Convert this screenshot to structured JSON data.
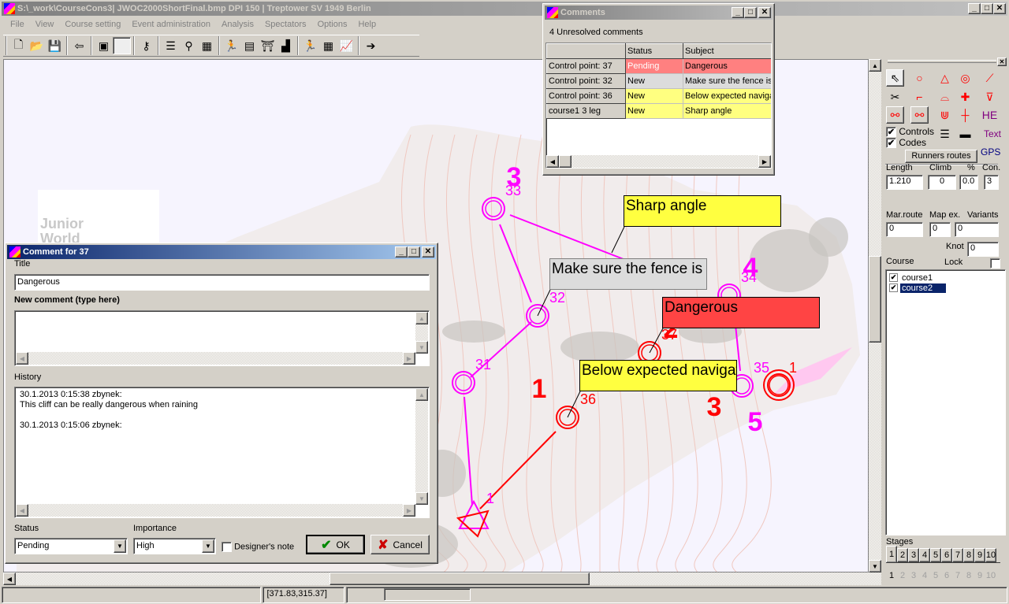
{
  "app": {
    "title": "S:\\_work\\CourseCons3| JWOC2000ShortFinal.bmp DPI 150 | Treptower SV 1949 Berlin"
  },
  "menu": [
    "File",
    "View",
    "Course setting",
    "Event administration",
    "Analysis",
    "Spectators",
    "Options",
    "Help"
  ],
  "toolbar": [
    {
      "name": "new-file",
      "glyph": "🗋"
    },
    {
      "name": "open-folder",
      "glyph": "📂"
    },
    {
      "name": "save",
      "glyph": "💾"
    },
    null,
    {
      "name": "exit",
      "glyph": "⇦"
    },
    null,
    {
      "name": "print-map",
      "glyph": "▣"
    },
    {
      "name": "blank",
      "glyph": ""
    },
    null,
    {
      "name": "key",
      "glyph": "⚷"
    },
    null,
    {
      "name": "list",
      "glyph": "☰"
    },
    {
      "name": "course-tree",
      "glyph": "⚲"
    },
    {
      "name": "grid-controls",
      "glyph": "▦"
    },
    null,
    {
      "name": "runner",
      "glyph": "🏃"
    },
    {
      "name": "counter",
      "glyph": "▤"
    },
    {
      "name": "finish-gate",
      "glyph": "⛩"
    },
    {
      "name": "podium",
      "glyph": "▟"
    },
    null,
    {
      "name": "runner-route",
      "glyph": "🏃"
    },
    {
      "name": "table",
      "glyph": "▦"
    },
    {
      "name": "chart",
      "glyph": "📈"
    },
    null,
    {
      "name": "runner-arrow",
      "glyph": "➔"
    }
  ],
  "comments_window": {
    "title": "Comments",
    "summary": "4 Unresolved comments",
    "headers": [
      "",
      "Status",
      "Subject"
    ],
    "rows": [
      {
        "item": "Control point: 37",
        "status": "Pending",
        "subject": "Dangerous",
        "color": "#ff8080",
        "text_color": "#ffffff"
      },
      {
        "item": "Control point: 32",
        "status": "New",
        "subject": "Make sure the fence is",
        "color": "#dcdcdc",
        "text_color": "#000000"
      },
      {
        "item": "Control point: 36",
        "status": "New",
        "subject": "Below expected naviga",
        "color": "#ffff80",
        "text_color": "#000000"
      },
      {
        "item": "course1 3 leg",
        "status": "New",
        "subject": "Sharp angle",
        "color": "#ffff80",
        "text_color": "#000000"
      }
    ]
  },
  "comment_dialog": {
    "title": "Comment for 37",
    "title_label": "Title",
    "title_value": "Dangerous",
    "new_comment_label": "New comment (type here)",
    "new_comment_value": "",
    "history_label": "History",
    "history": [
      "30.1.2013 0:15:38 zbynek:",
      "This cliff can be really dangerous when raining",
      "",
      "30.1.2013 0:15:06 zbynek:"
    ],
    "status_label": "Status",
    "status_value": "Pending",
    "importance_label": "Importance",
    "importance_value": "High",
    "designers_note_label": "Designer's note",
    "designers_note_checked": false,
    "ok_label": "OK",
    "cancel_label": "Cancel"
  },
  "map": {
    "watermark": [
      "Junior",
      "World"
    ],
    "callouts": [
      {
        "text": "Sharp angle",
        "color": "#ffff40"
      },
      {
        "text": "Make sure the fence is",
        "color": "#dcdcdc"
      },
      {
        "text": "Dangerous",
        "color": "#ff4444"
      },
      {
        "text": "Below expected navigation",
        "color": "#ffff40"
      }
    ],
    "controls": [
      {
        "code": "33",
        "color": "#ff00ff"
      },
      {
        "code": "32",
        "color": "#ff00ff"
      },
      {
        "code": "31",
        "color": "#ff00ff"
      },
      {
        "code": "36",
        "color": "#ff0000"
      },
      {
        "code": "37",
        "color": "#ff0000"
      },
      {
        "code": "34",
        "color": "#ff00ff"
      },
      {
        "code": "35",
        "color": "#ff00ff"
      },
      {
        "code": "1",
        "color": "#ff0000"
      },
      {
        "code": "1",
        "color": "#ff00ff"
      }
    ],
    "order_numbers": [
      {
        "n": "3",
        "color": "#ff00ff"
      },
      {
        "n": "4",
        "color": "#ff00ff"
      },
      {
        "n": "5",
        "color": "#ff00ff"
      },
      {
        "n": "1",
        "color": "#ff0000"
      },
      {
        "n": "2",
        "color": "#ff0000"
      },
      {
        "n": "3",
        "color": "#ff0000"
      }
    ]
  },
  "status_bar": {
    "coords": "[371.83,315.37]"
  },
  "right_panel": {
    "tools": [
      {
        "name": "pointer",
        "glyph": "⇖",
        "color": "#000"
      },
      {
        "name": "control-circle",
        "glyph": "○",
        "color": "#f00"
      },
      {
        "name": "start-triangle",
        "glyph": "△",
        "color": "#f00"
      },
      {
        "name": "finish-circle",
        "glyph": "◎",
        "color": "#f00"
      },
      {
        "name": "crossing-point",
        "glyph": "⟋",
        "color": "#f00"
      },
      {
        "name": "scissors",
        "glyph": "✂",
        "color": "#000"
      },
      {
        "name": "marked-route",
        "glyph": "⌐",
        "color": "#f00"
      },
      {
        "name": "water-point",
        "glyph": "⌓",
        "color": "#f00"
      },
      {
        "name": "first-aid",
        "glyph": "✚",
        "color": "#f00"
      },
      {
        "name": "map-exchange",
        "glyph": "⊽",
        "color": "#f00"
      },
      {
        "name": "course-net",
        "glyph": "⚯",
        "color": "#f00"
      },
      {
        "name": "course-net-edit",
        "glyph": "⚯",
        "color": "#f00"
      },
      {
        "name": "forbidden-route",
        "glyph": "⋓",
        "color": "#f00"
      },
      {
        "name": "crosshair",
        "glyph": "┼",
        "color": "#f00"
      },
      {
        "name": "he",
        "glyph": "HE",
        "color": "#800080"
      },
      {
        "name": "description-sheet",
        "glyph": "☰",
        "color": "#000"
      },
      {
        "name": "legend-tool",
        "glyph": "▬",
        "color": "#000"
      },
      {
        "name": "text",
        "glyph": "Text",
        "color": "#800080"
      }
    ],
    "controls_label": "Controls",
    "controls_checked": true,
    "codes_label": "Codes",
    "codes_checked": true,
    "runners_routes_label": "Runners routes",
    "gps_label": "GPS",
    "length_label": "Length",
    "length_value": "1.210",
    "climb_label": "Climb",
    "climb_value": "0",
    "percent_label": "%",
    "percent_value": "0.0",
    "con_label": "Con.",
    "con_value": "3",
    "marroute_label": "Mar.route",
    "marroute_value": "0",
    "mapex_label": "Map ex.",
    "mapex_value": "0",
    "variants_label": "Variants",
    "variants_value": "0",
    "knot_label": "Knot",
    "knot_value": "0",
    "course_label": "Course",
    "lock_label": "Lock",
    "lock_checked": false,
    "courses": [
      {
        "name": "course1",
        "checked": true,
        "selected": false
      },
      {
        "name": "course2",
        "checked": true,
        "selected": true
      }
    ],
    "stages_label": "Stages",
    "stages": [
      "1",
      "2",
      "3",
      "4",
      "5",
      "6",
      "7",
      "8",
      "9",
      "10"
    ],
    "active_stage": "1"
  }
}
